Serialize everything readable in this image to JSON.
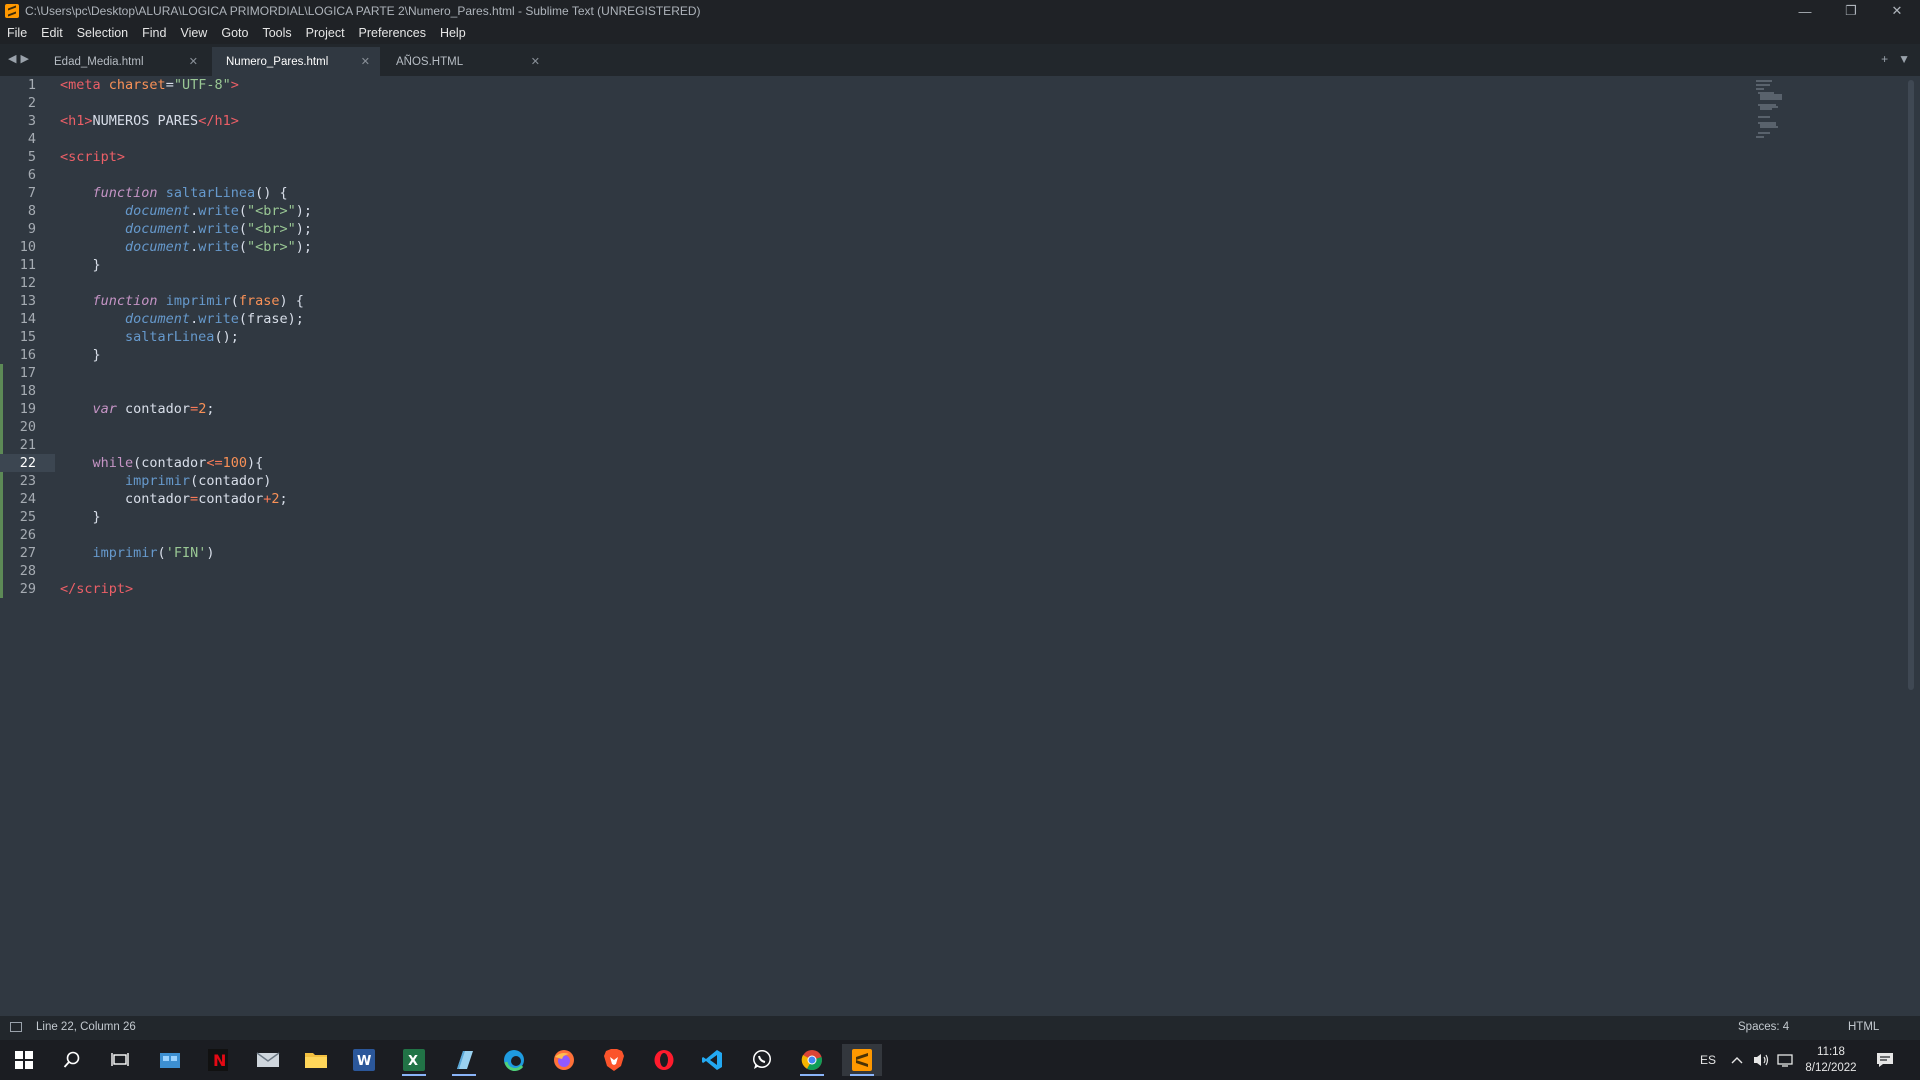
{
  "window": {
    "title": "C:\\Users\\pc\\Desktop\\ALURA\\LOGICA PRIMORDIAL\\LOGICA PARTE 2\\Numero_Pares.html - Sublime Text (UNREGISTERED)",
    "controls": [
      "—",
      "❐",
      "✕"
    ]
  },
  "menu": [
    "File",
    "Edit",
    "Selection",
    "Find",
    "View",
    "Goto",
    "Tools",
    "Project",
    "Preferences",
    "Help"
  ],
  "tabs": [
    {
      "label": "Edad_Media.html",
      "active": false
    },
    {
      "label": "Numero_Pares.html",
      "active": true
    },
    {
      "label": "AÑOS.HTML",
      "active": false
    }
  ],
  "editor": {
    "current_line": 22,
    "line_numbers": [
      "1",
      "2",
      "3",
      "4",
      "5",
      "6",
      "7",
      "8",
      "9",
      "10",
      "11",
      "12",
      "13",
      "14",
      "15",
      "16",
      "17",
      "18",
      "19",
      "20",
      "21",
      "22",
      "23",
      "24",
      "25",
      "26",
      "27",
      "28",
      "29"
    ]
  },
  "status": {
    "position": "Line 22, Column 26",
    "spaces": "Spaces: 4",
    "syntax": "HTML"
  },
  "taskbar": {
    "language": "ES",
    "time": "11:18",
    "date": "8/12/2022"
  },
  "colors": {
    "background": "#303841",
    "tag": "#ec5f67",
    "string": "#99c794",
    "keyword": "#c594c5",
    "function": "#6699cc",
    "number": "#f99157"
  }
}
